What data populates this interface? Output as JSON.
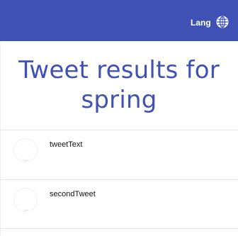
{
  "header": {
    "lang_label": "Lang",
    "globe_icon": "globe-icon",
    "bar_color": "#3f51b5"
  },
  "main": {
    "title": "Tweet results for spring",
    "title_color": "#3f51b5"
  },
  "tweets": [
    {
      "text": "tweetText"
    },
    {
      "text": "secondTweet"
    }
  ]
}
